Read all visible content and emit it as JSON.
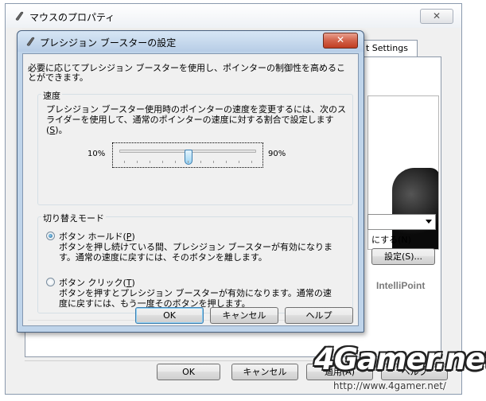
{
  "back_window": {
    "title": "マウスのプロパティ",
    "close_glyph": "✕",
    "tab_label": "t Settings",
    "checkbox_label": "にする(N)",
    "settings_button": "設定(S)...",
    "brand": "IntelliPoint",
    "footer": {
      "ok": "OK",
      "cancel": "キャンセル",
      "apply": "適用(A)",
      "help": "ヘルプ"
    }
  },
  "dialog": {
    "title": "プレシジョン ブースターの設定",
    "close_glyph": "✕",
    "intro": "必要に応じてプレシジョン ブースターを使用し、ポインターの制御性を高めることができます。",
    "speed": {
      "label": "速度",
      "description_before": "プレシジョン ブースター使用時のポインターの速度を変更するには、次のスライダーを使用して、通常のポインターの速度に対する割合で設定します(",
      "description_key": "S",
      "description_after": ")。",
      "min_label": "10%",
      "max_label": "90%",
      "value": 50
    },
    "mode": {
      "label": "切り替えモード",
      "hold": {
        "label_text": "ボタン ホールド(",
        "label_key": "P",
        "label_end": ")",
        "selected": true,
        "description": "ボタンを押し続けている間、プレシジョン ブースターが有効になります。通常の速度に戻すには、そのボタンを離します。"
      },
      "click": {
        "label_text": "ボタン クリック(",
        "label_key": "T",
        "label_end": ")",
        "selected": false,
        "description": "ボタンを押すとプレシジョン ブースターが有効になります。通常の速度に戻すには、もう一度そのボタンを押します。"
      }
    },
    "buttons": {
      "ok": "OK",
      "cancel": "キャンセル",
      "help": "ヘルプ"
    }
  },
  "watermark": {
    "logo": "4Gamer.net",
    "url": "http://www.4gamer.net/"
  },
  "colors": {
    "dialog_frame": "#bfd4ea",
    "close_red": "#c03d22",
    "accent": "#3c7fb1"
  }
}
